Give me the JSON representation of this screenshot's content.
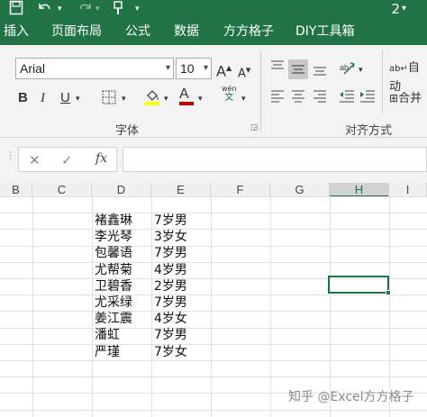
{
  "titlebar": {
    "right_text": "2"
  },
  "menu": [
    "插入",
    "页面布局",
    "公式",
    "数据",
    "方方格子",
    "DIY工具箱"
  ],
  "ribbon": {
    "font_name": "Arial",
    "font_size": "10",
    "grow_font": "A",
    "shrink_font": "A",
    "bold": "B",
    "italic": "I",
    "underline": "U",
    "font_color": "A",
    "phonetic_top": "wén",
    "phonetic_bottom": "文",
    "font_group_label": "字体",
    "align_group_label": "对齐方式",
    "wrap_text": "自动",
    "merge": "合并"
  },
  "formula_bar": {
    "cancel": "✕",
    "enter": "✓",
    "fx": "fx",
    "value": ""
  },
  "columns": [
    "B",
    "C",
    "D",
    "E",
    "F",
    "G",
    "H",
    "I"
  ],
  "selected_column": "H",
  "rows": [
    {
      "name": "褚鑫琳",
      "info": "7岁男"
    },
    {
      "name": "李光琴",
      "info": "3岁女"
    },
    {
      "name": "包馨语",
      "info": "7岁男"
    },
    {
      "name": "尤帮菊",
      "info": "4岁男"
    },
    {
      "name": "卫碧香",
      "info": "2岁男"
    },
    {
      "name": "尤采绿",
      "info": "7岁男"
    },
    {
      "name": "姜江震",
      "info": "4岁女"
    },
    {
      "name": "潘虹",
      "info": "7岁男"
    },
    {
      "name": "严瑾",
      "info": "7岁女"
    }
  ],
  "watermark": "知乎 @Excel方方格子",
  "colors": {
    "excel_green": "#217346",
    "highlight_yellow": "#ffff00",
    "font_red": "#c00000"
  }
}
